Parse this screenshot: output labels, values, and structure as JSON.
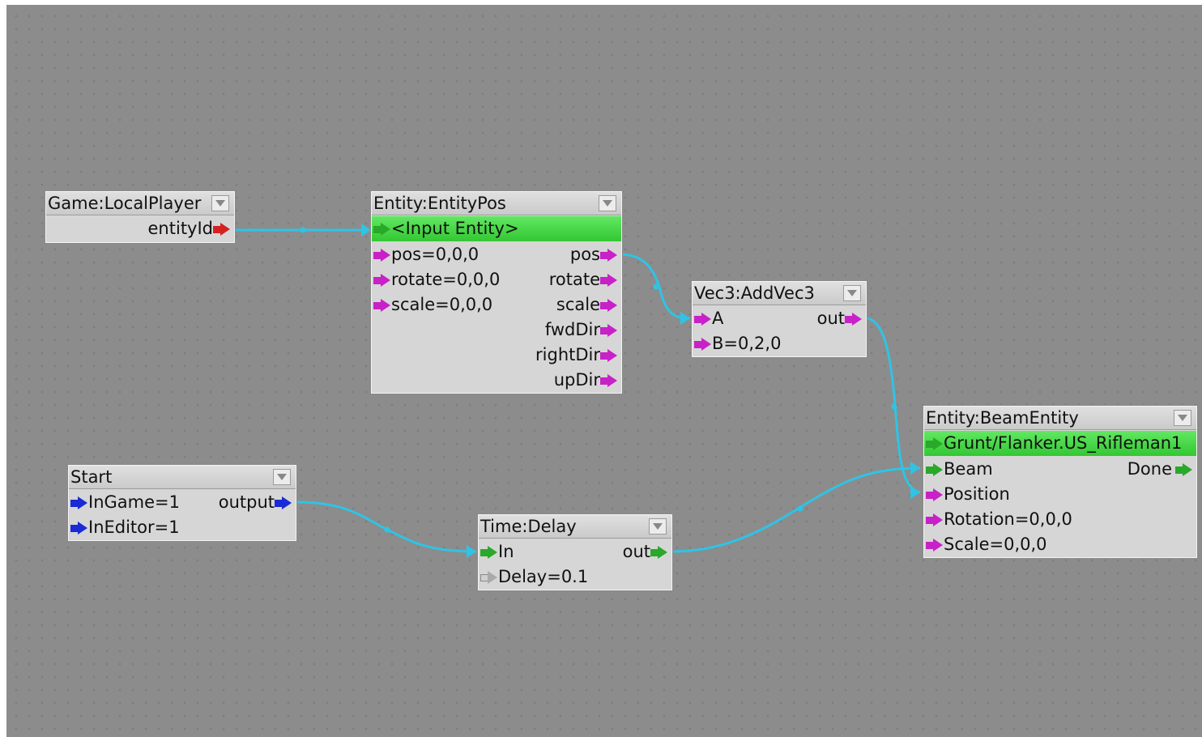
{
  "colors": {
    "background": "#8c8c8c",
    "node_body": "#d6d6d6",
    "entity_row": "#4cd84c",
    "link": "#2ec4e6"
  },
  "nodes": {
    "localplayer": {
      "title": "Game:LocalPlayer",
      "outputs": [
        "entityId"
      ]
    },
    "entitypos": {
      "title": "Entity:EntityPos",
      "entity": "<Input Entity>",
      "inputs": [
        "pos=0,0,0",
        "rotate=0,0,0",
        "scale=0,0,0"
      ],
      "outputs": [
        "pos",
        "rotate",
        "scale",
        "fwdDir",
        "rightDir",
        "upDir"
      ]
    },
    "addvec3": {
      "title": "Vec3:AddVec3",
      "inputs": [
        "A",
        "B=0,2,0"
      ],
      "outputs": [
        "out"
      ]
    },
    "beamentity": {
      "title": "Entity:BeamEntity",
      "entity": "Grunt/Flanker.US_Rifleman1",
      "inputs": [
        "Beam",
        "Position",
        "Rotation=0,0,0",
        "Scale=0,0,0"
      ],
      "outputs": [
        "Done"
      ]
    },
    "start": {
      "title": "Start",
      "inputs": [
        "InGame=1",
        "InEditor=1"
      ],
      "outputs": [
        "output"
      ]
    },
    "delay": {
      "title": "Time:Delay",
      "inputs": [
        "In",
        "Delay=0.1"
      ],
      "outputs": [
        "out"
      ]
    }
  }
}
